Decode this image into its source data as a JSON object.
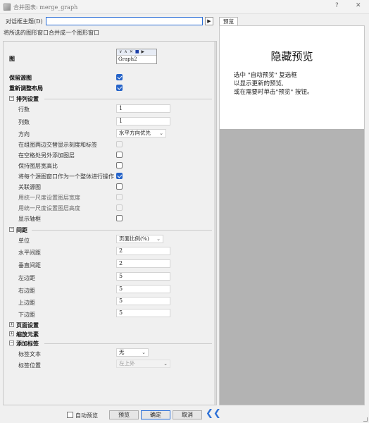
{
  "window": {
    "title": "合并图表: merge_graph",
    "help_btn": "?",
    "close_btn": "✕"
  },
  "header": {
    "theme_label": "对话框主题(D)",
    "theme_value": "",
    "play_btn": "▶",
    "description": "将所选的图形窗口合并成一个图形窗口"
  },
  "graphs": {
    "label": "图",
    "toolbar": [
      "∨",
      "∧",
      "✕",
      "■",
      "▶"
    ],
    "name": "Graph2"
  },
  "options": {
    "keep_source": "保留源图",
    "keep_source_checked": true,
    "relayout": "重新调整布局",
    "relayout_checked": true
  },
  "arrange": {
    "toggle": "−",
    "title": "排列设置",
    "rows_label": "行数",
    "rows_value": "1",
    "cols_label": "列数",
    "cols_value": "1",
    "direction_label": "方向",
    "direction_value": "水平方向优先",
    "stagger_label": "在组图两边交替显示刻度和标签",
    "extra_layer_label": "在空格处另外添加图层",
    "keep_ratio_label": "保持图层宽高比",
    "treat_whole_label": "将每个源图窗口作为一个整体进行操作",
    "treat_whole_checked": true,
    "link_label": "关联源图",
    "uniform_width_label": "用统一尺度设置图层宽度",
    "uniform_height_label": "用统一尺度设置图层高度",
    "show_frame_label": "显示轴框"
  },
  "spacing": {
    "toggle": "−",
    "title": "间距",
    "unit_label": "单位",
    "unit_value": "页面比例(%)",
    "hgap_label": "水平间距",
    "hgap_value": "2",
    "vgap_label": "垂直间距",
    "vgap_value": "2",
    "left_label": "左边距",
    "left_value": "5",
    "right_label": "右边距",
    "right_value": "5",
    "top_label": "上边距",
    "top_value": "5",
    "bottom_label": "下边距",
    "bottom_value": "5"
  },
  "page_setup": {
    "toggle": "+",
    "title": "页面设置"
  },
  "scale": {
    "toggle": "+",
    "title": "缩放元素"
  },
  "labels": {
    "toggle": "−",
    "title": "添加标签",
    "text_label": "标签文本",
    "text_value": "无",
    "pos_label": "标签位置",
    "pos_value": "左上外"
  },
  "preview": {
    "tab": "预览",
    "title": "隐藏预览",
    "message": "选中 \"自动预览\" 复选框\n以显示更新的预览,\n或在需要时单击\"预览\" 按钮。"
  },
  "footer": {
    "auto_preview": "自动预览",
    "preview": "预览",
    "ok": "确定",
    "cancel": "取消",
    "collapse": "❮❮"
  }
}
